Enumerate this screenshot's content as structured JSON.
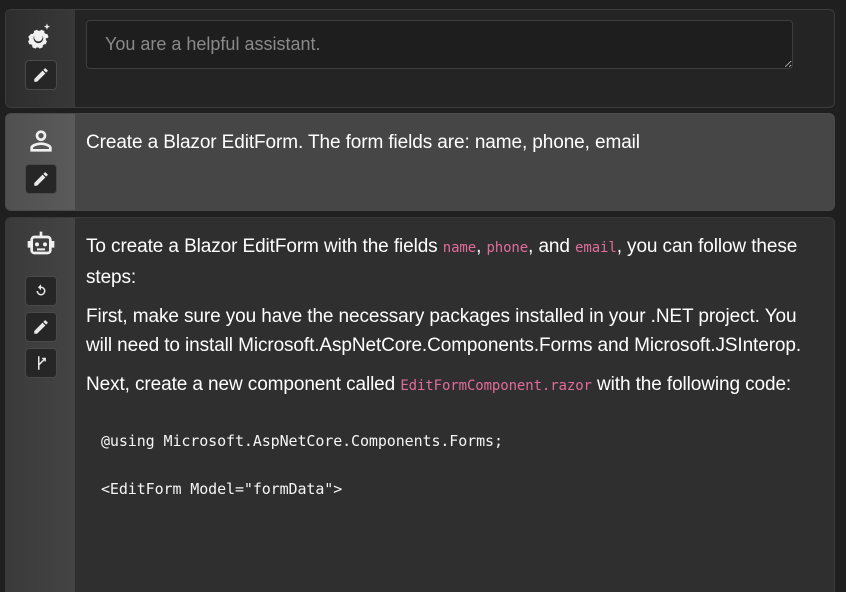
{
  "system": {
    "placeholder": "You are a helpful assistant."
  },
  "user": {
    "text": "Create a Blazor EditForm. The form fields are: name, phone, email"
  },
  "assistant": {
    "p1_a": "To create a Blazor EditForm with the fields ",
    "code_name": "name",
    "sep1": ", ",
    "code_phone": "phone",
    "sep2": ", and ",
    "code_email": "email",
    "p1_b": ", you can follow these steps:",
    "p2": "First, make sure you have the necessary packages installed in your .NET project. You will need to install Microsoft.AspNetCore.Components.Forms and Microsoft.JSInterop.",
    "p3_a": "Next, create a new component called ",
    "code_file": "EditFormComponent.razor",
    "p3_b": " with the following code:",
    "code_lines": [
      "@using Microsoft.AspNetCore.Components.Forms;",
      "<EditForm Model=\"formData\">"
    ]
  },
  "icons": {
    "system_role": "gear-sparkle-icon",
    "user_role": "person-icon",
    "assistant_role": "robot-icon",
    "edit": "pencil-icon",
    "regenerate": "refresh-icon",
    "branch": "branch-icon"
  },
  "colors": {
    "inline_code": "#e06c9a",
    "user_bg": "#464646",
    "assistant_bg": "#2f2f2f"
  }
}
